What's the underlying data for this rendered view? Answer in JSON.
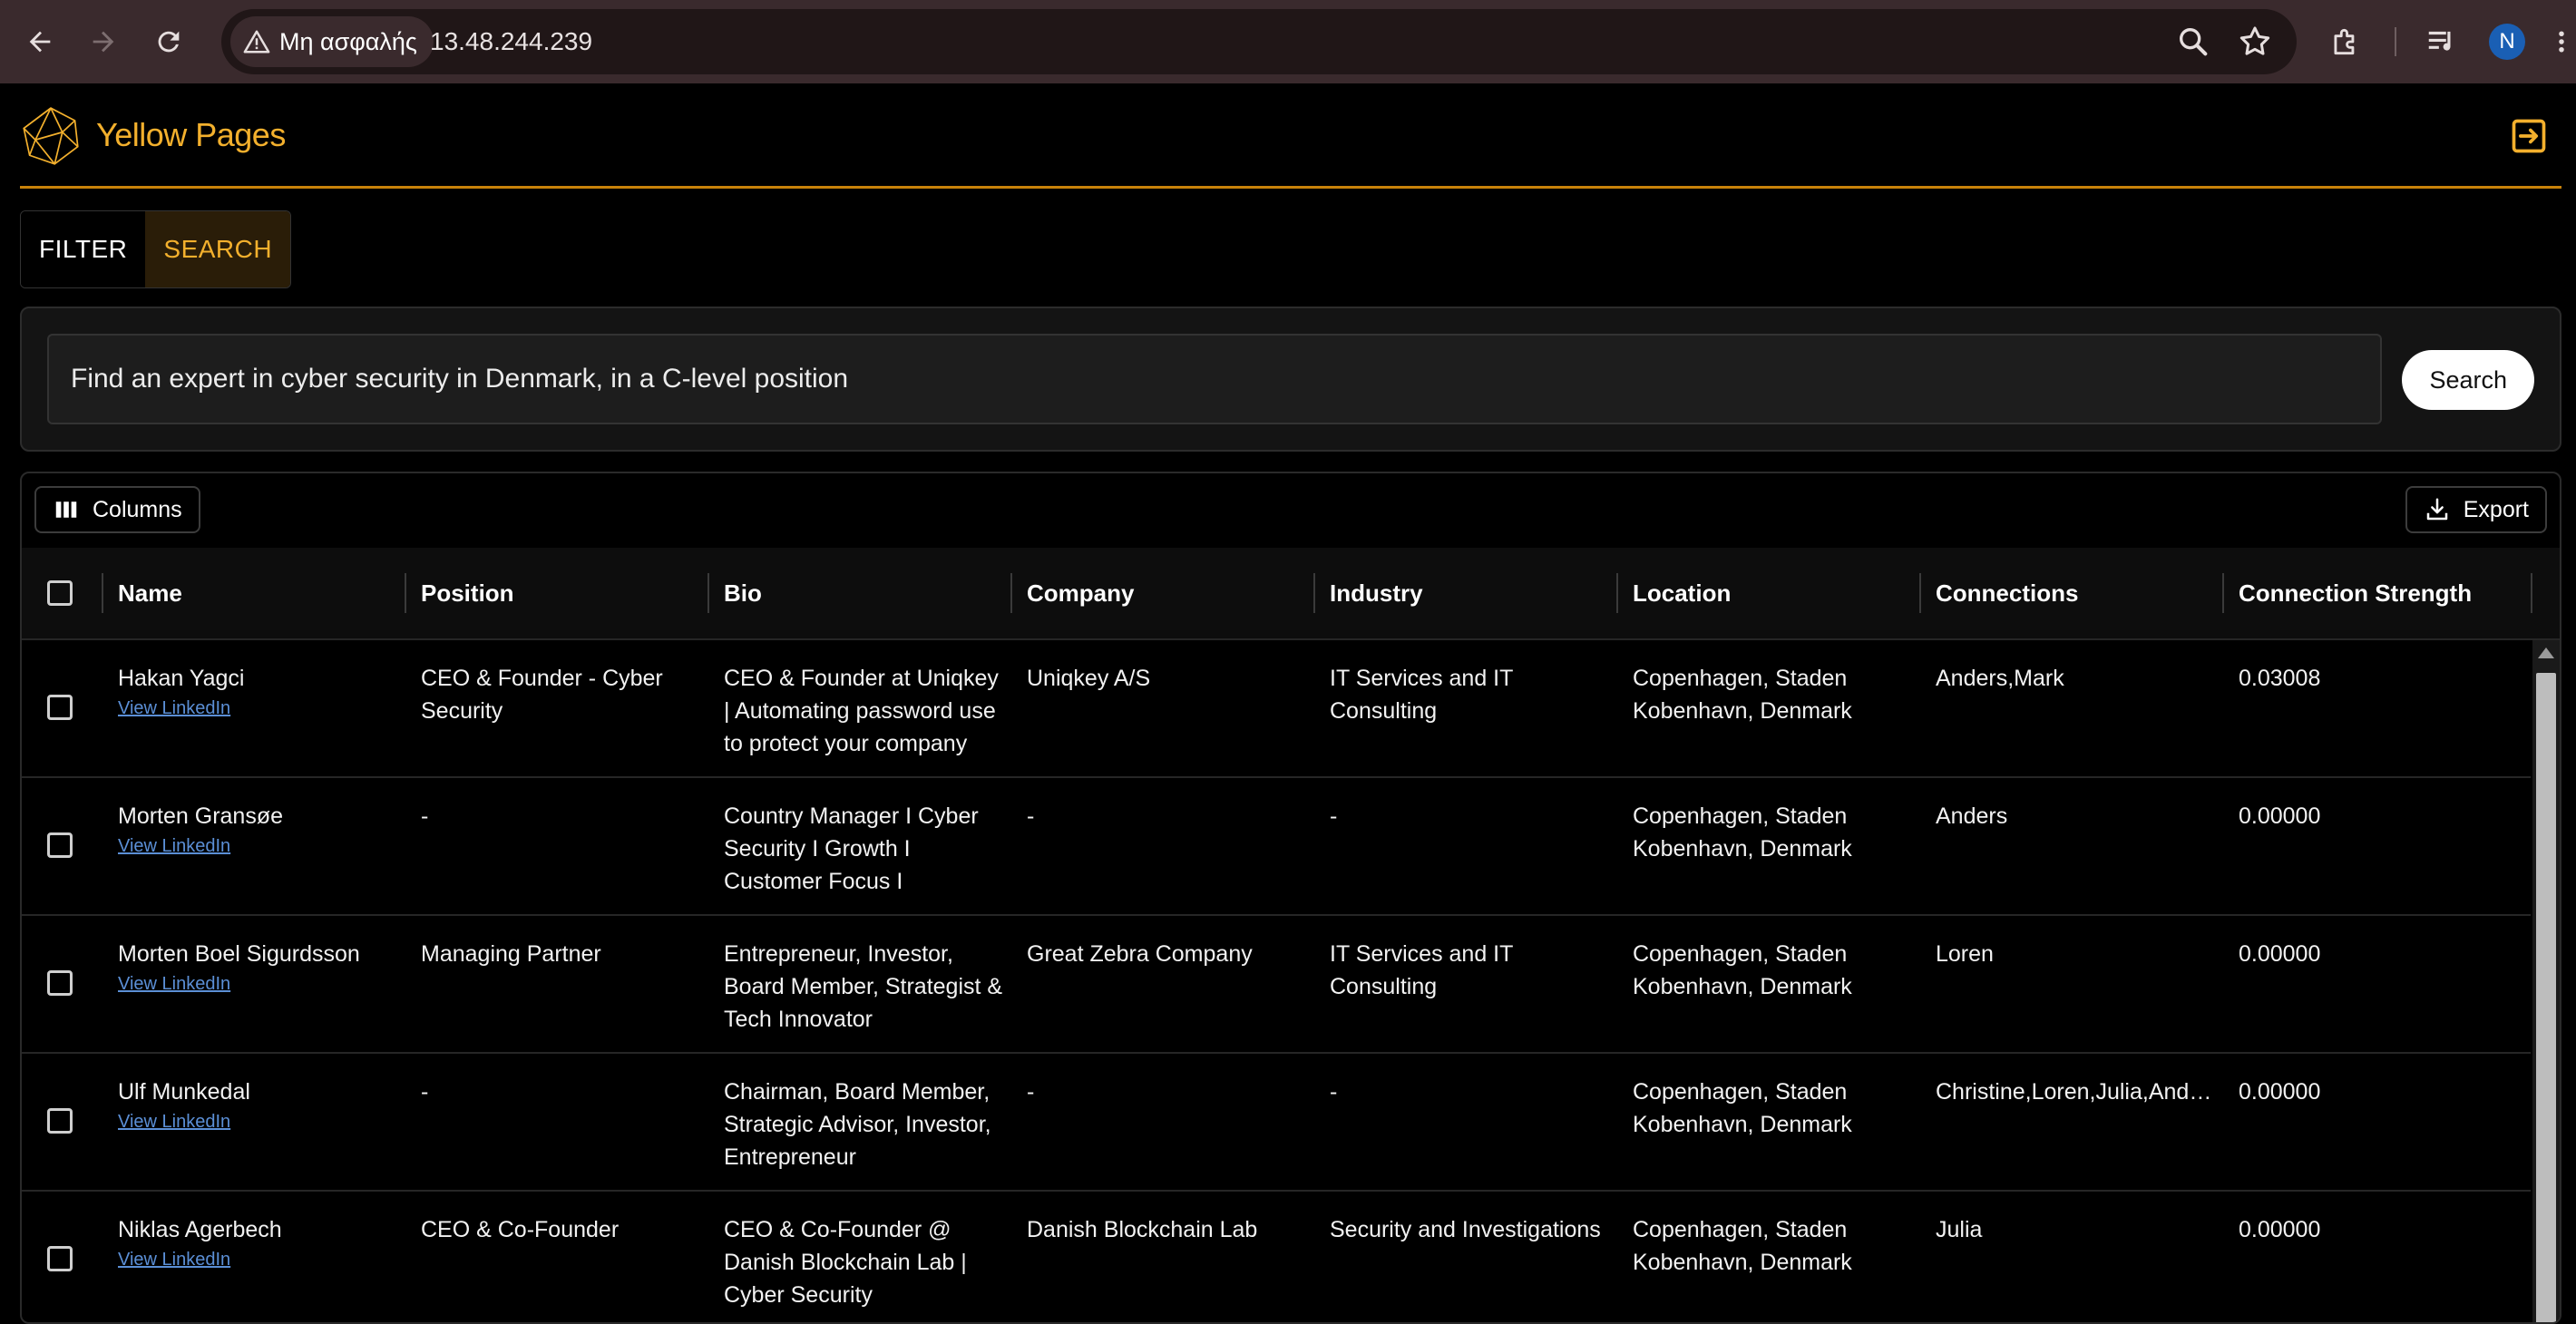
{
  "browser": {
    "security_label": "Μη ασφαλής",
    "url": "13.48.244.239",
    "avatar_initial": "N"
  },
  "app": {
    "brand": "Yellow Pages"
  },
  "tabs": [
    {
      "label": "FILTER",
      "active": false
    },
    {
      "label": "SEARCH",
      "active": true
    }
  ],
  "search": {
    "query": "Find an expert in cyber security in Denmark, in a C-level position",
    "button_label": "Search"
  },
  "grid": {
    "columns_label": "Columns",
    "export_label": "Export",
    "headers": [
      "Name",
      "Position",
      "Bio",
      "Company",
      "Industry",
      "Location",
      "Connections",
      "Connection Strength"
    ],
    "link_label": "View LinkedIn",
    "rows": [
      {
        "name": "Hakan Yagci",
        "position": "CEO & Founder - Cyber Security",
        "bio": "CEO & Founder at Uniqkey | Automating password use to protect your company",
        "company": "Uniqkey A/S",
        "industry": "IT Services and IT Consulting",
        "location": "Copenhagen, Staden Kobenhavn, Denmark",
        "connections": "Anders,Mark",
        "strength": "0.03008"
      },
      {
        "name": "Morten Gransøe",
        "position": "-",
        "bio": "Country Manager I Cyber Security I Growth I Customer Focus I",
        "company": "-",
        "industry": "-",
        "location": "Copenhagen, Staden Kobenhavn, Denmark",
        "connections": "Anders",
        "strength": "0.00000"
      },
      {
        "name": "Morten Boel Sigurdsson",
        "position": "Managing Partner",
        "bio": "Entrepreneur, Investor, Board Member, Strategist & Tech Innovator",
        "company": "Great Zebra Company",
        "industry": "IT Services and IT Consulting",
        "location": "Copenhagen, Staden Kobenhavn, Denmark",
        "connections": "Loren",
        "strength": "0.00000"
      },
      {
        "name": "Ulf Munkedal",
        "position": "-",
        "bio": "Chairman, Board Member, Strategic Advisor, Investor, Entrepreneur",
        "company": "-",
        "industry": "-",
        "location": "Copenhagen, Staden Kobenhavn, Denmark",
        "connections": "Christine,Loren,Julia,Anders,Mark",
        "strength": "0.00000"
      },
      {
        "name": "Niklas Agerbech",
        "position": "CEO & Co-Founder",
        "bio": "CEO & Co-Founder @ Danish Blockchain Lab | Cyber Security",
        "company": "Danish Blockchain Lab",
        "industry": "Security and Investigations",
        "location": "Copenhagen, Staden Kobenhavn, Denmark",
        "connections": "Julia",
        "strength": "0.00000"
      }
    ]
  },
  "colors": {
    "accent": "#f3b02d",
    "header_rule": "#c8820a",
    "link": "#5b8fd6",
    "chrome": "#3a2a2d"
  },
  "icons": {
    "back": "arrow-left-icon",
    "forward": "arrow-right-icon",
    "reload": "reload-icon",
    "warning": "warning-triangle-icon",
    "zoom": "zoom-icon",
    "bookmark": "star-icon",
    "extensions": "puzzle-icon",
    "media": "media-control-icon",
    "menu": "kebab-menu-icon",
    "logo": "polyhedron-logo-icon",
    "logout": "logout-icon",
    "columns": "columns-icon",
    "export": "download-icon"
  }
}
